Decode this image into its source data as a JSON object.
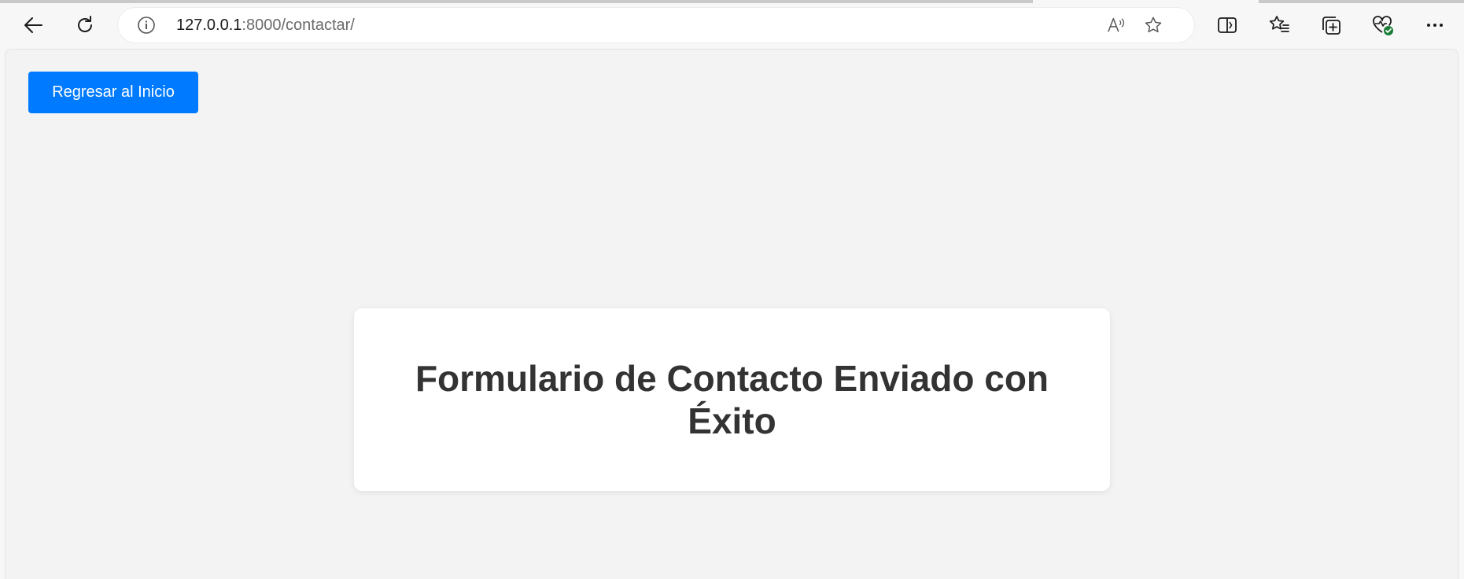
{
  "browser": {
    "url_host": "127.0.0.1",
    "url_path": ":8000/contactar/",
    "toolbar": {
      "back": "back-arrow-icon",
      "refresh": "refresh-icon",
      "site_info": "info-icon",
      "read_aloud": "read-aloud-icon",
      "favorite": "star-icon",
      "split_screen": "split-screen-icon",
      "favorites": "favorites-list-icon",
      "collections": "collections-icon",
      "browser_essentials": "heart-pulse-icon",
      "more": "more-icon"
    }
  },
  "page": {
    "back_button_label": "Regresar al Inicio",
    "heading": "Formulario de Contacto Enviado con Éxito"
  },
  "colors": {
    "primary_button": "#007bff",
    "page_background": "#f3f3f3",
    "card_background": "#ffffff",
    "heading_text": "#333333",
    "essentials_badge": "#1a7f37"
  }
}
